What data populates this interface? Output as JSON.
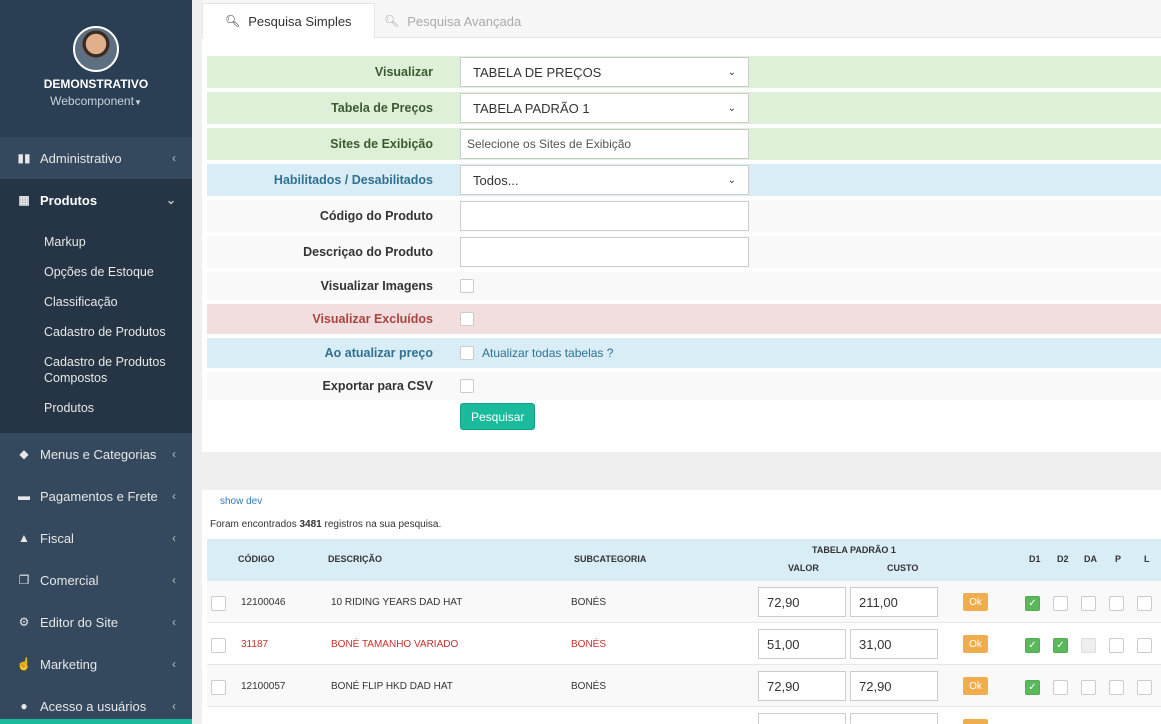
{
  "sidebar": {
    "profile": {
      "name": "DEMONSTRATIVO",
      "company": "Webcomponent"
    },
    "menu": [
      {
        "label": "Administrativo",
        "icon": "bar-chart-icon"
      },
      {
        "label": "Produtos",
        "icon": "table-icon",
        "expanded": true
      },
      {
        "label": "Menus e Categorias",
        "icon": "tags-icon"
      },
      {
        "label": "Pagamentos e Frete",
        "icon": "truck-icon"
      },
      {
        "label": "Fiscal",
        "icon": "area-chart-icon"
      },
      {
        "label": "Comercial",
        "icon": "copy-icon"
      },
      {
        "label": "Editor do Site",
        "icon": "gear-icon"
      },
      {
        "label": "Marketing",
        "icon": "thumbs-up-icon"
      },
      {
        "label": "Acesso a usuários",
        "icon": "user-icon"
      }
    ],
    "submenu": [
      "Markup",
      "Opções de Estoque",
      "Classificação",
      "Cadastro de Produtos",
      "Cadastro de Produtos Compostos",
      "Produtos"
    ]
  },
  "tabs": {
    "simple": "Pesquisa Simples",
    "advanced": "Pesquisa Avançada"
  },
  "form": {
    "visualizar": {
      "label": "Visualizar",
      "value": "TABELA DE PREÇOS"
    },
    "tabela": {
      "label": "Tabela de Preços",
      "value": "TABELA PADRÃO 1"
    },
    "sites": {
      "label": "Sites de Exibição",
      "placeholder": "Selecione os Sites de Exibição"
    },
    "habilitados": {
      "label": "Habilitados / Desabilitados",
      "value": "Todos..."
    },
    "codigo": {
      "label": "Código do Produto",
      "value": ""
    },
    "descricao": {
      "label": "Descriçao do Produto",
      "value": ""
    },
    "imagens": {
      "label": "Visualizar Imagens"
    },
    "excluidos": {
      "label": "Visualizar Excluídos"
    },
    "atualizar": {
      "label": "Ao atualizar preço",
      "checkbox_label": "Atualizar todas tabelas ?"
    },
    "csv": {
      "label": "Exportar para CSV"
    },
    "search_button": "Pesquisar"
  },
  "results": {
    "show_dev": "show dev",
    "found_prefix": "Foram encontrados",
    "count": "3481",
    "found_suffix": "registros na sua pesquisa.",
    "headers": {
      "codigo": "CÓDIGO",
      "descricao": "DESCRIÇÃO",
      "subcategoria": "SUBCATEGORIA",
      "tabela": "TABELA PADRÃO 1",
      "valor": "VALOR",
      "custo": "CUSTO",
      "d1": "D1",
      "d2": "D2",
      "da": "DA",
      "p": "P",
      "l": "L"
    },
    "rows": [
      {
        "codigo": "12100046",
        "descricao": "10 RIDING YEARS DAD HAT",
        "subcategoria": "BONÉS",
        "valor": "72,90",
        "custo": "211,00",
        "ok": "Ok"
      },
      {
        "codigo": "31187",
        "descricao": "BONÉ TAMANHO VARIADO",
        "subcategoria": "BONÉS",
        "valor": "51,00",
        "custo": "31,00",
        "ok": "Ok"
      },
      {
        "codigo": "12100057",
        "descricao": "BONÉ FLIP HKD DAD HAT",
        "subcategoria": "BONÉS",
        "valor": "72,90",
        "custo": "72,90",
        "ok": "Ok"
      }
    ]
  },
  "colors": {
    "sidebar": "#2a3f54",
    "accent": "#1abb9c",
    "ok": "#f0ad4e",
    "danger_text": "#c9302c"
  }
}
